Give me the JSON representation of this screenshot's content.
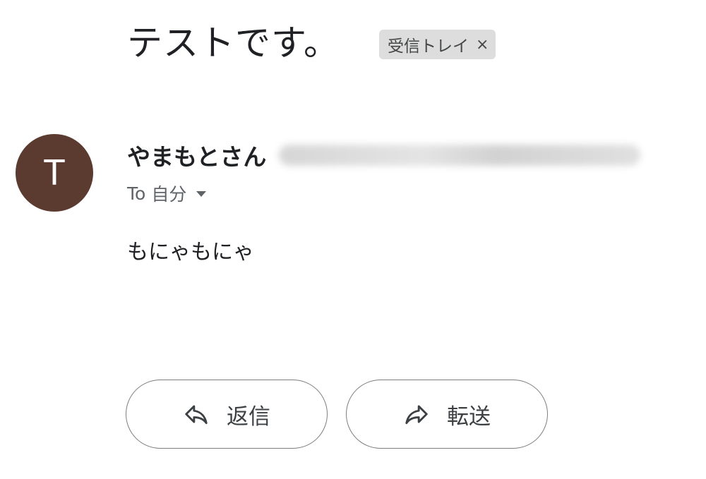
{
  "email": {
    "subject": "テストです。",
    "label": {
      "text": "受信トレイ",
      "close_symbol": "×"
    },
    "sender": {
      "initial": "T",
      "name": "やまもとさん",
      "avatar_color": "#5b3b30"
    },
    "recipient": {
      "prefix": "To",
      "name": "自分"
    },
    "body": "もにゃもにゃ"
  },
  "actions": {
    "reply_label": "返信",
    "forward_label": "転送"
  },
  "icons": {
    "reply": "reply-icon",
    "forward": "forward-icon",
    "dropdown": "chevron-down-icon"
  }
}
